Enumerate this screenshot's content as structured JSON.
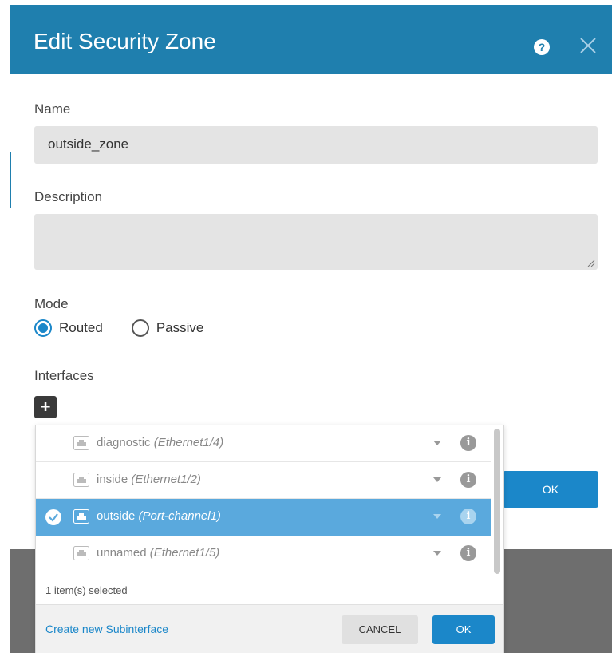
{
  "dialog": {
    "title": "Edit Security Zone",
    "help_icon": "question-circle-icon",
    "close_icon": "close-icon",
    "ok_label": "OK",
    "accent_color": "#1f7fae"
  },
  "form": {
    "name_label": "Name",
    "name_value": "outside_zone",
    "description_label": "Description",
    "description_value": "",
    "mode_label": "Mode",
    "mode_options": [
      {
        "label": "Routed",
        "checked": true
      },
      {
        "label": "Passive",
        "checked": false
      }
    ],
    "interfaces_label": "Interfaces",
    "add_icon": "plus-icon"
  },
  "interface_picker": {
    "items": [
      {
        "name": "diagnostic",
        "port": "(Ethernet1/4)",
        "selected": false
      },
      {
        "name": "inside",
        "port": "(Ethernet1/2)",
        "selected": false
      },
      {
        "name": "outside",
        "port": "(Port-channel1)",
        "selected": true
      },
      {
        "name": "unnamed",
        "port": "(Ethernet1/5)",
        "selected": false
      }
    ],
    "selected_count": "1 item(s) selected",
    "create_link": "Create new Subinterface",
    "cancel_label": "CANCEL",
    "ok_label": "OK",
    "selected_color": "#5aa9dd"
  }
}
